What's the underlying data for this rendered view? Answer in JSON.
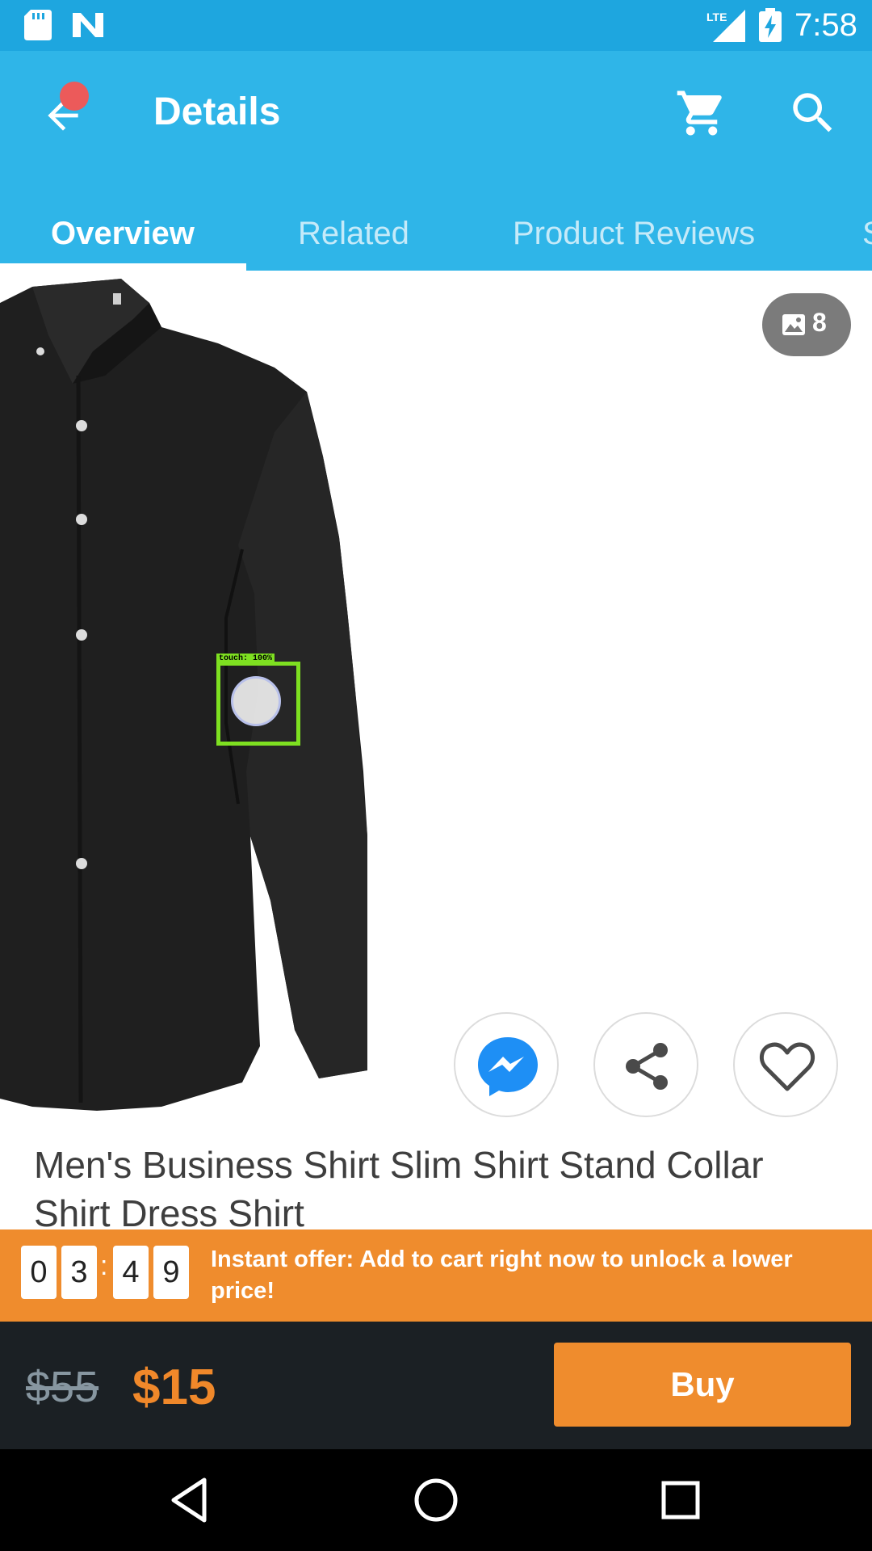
{
  "status_bar": {
    "time": "7:58",
    "network_label": "LTE",
    "icons": [
      "sd-card-icon",
      "n-notification-icon",
      "signal-icon",
      "battery-charging-icon"
    ]
  },
  "app_bar": {
    "title": "Details",
    "back_icon": "arrow-back-icon",
    "cart_icon": "cart-icon",
    "search_icon": "search-icon",
    "accent_color": "#2fb5e8"
  },
  "tabs": [
    {
      "label": "Overview",
      "active": true
    },
    {
      "label": "Related",
      "active": false
    },
    {
      "label": "Product Reviews",
      "active": false
    },
    {
      "label": "S",
      "active": false
    }
  ],
  "gallery": {
    "image_count": "8",
    "image_icon": "image-icon"
  },
  "touch_overlay": {
    "label": "touch: 100%"
  },
  "actions": [
    {
      "name": "messenger-button",
      "icon": "messenger-icon"
    },
    {
      "name": "share-button",
      "icon": "share-icon"
    },
    {
      "name": "wishlist-button",
      "icon": "heart-icon"
    }
  ],
  "product": {
    "title": "Men's Business Shirt Slim Shirt Stand Collar Shirt Dress Shirt"
  },
  "offer": {
    "timer": [
      "0",
      "3",
      "4",
      "9"
    ],
    "separator": ":",
    "text": "Instant offer: Add to cart right now to unlock a lower price!",
    "color": "#ef8c2d"
  },
  "price": {
    "original": "$55",
    "current": "$15",
    "buy_label": "Buy"
  },
  "nav_bar": {
    "icons": [
      "back-triangle-icon",
      "home-circle-icon",
      "recents-square-icon"
    ]
  }
}
